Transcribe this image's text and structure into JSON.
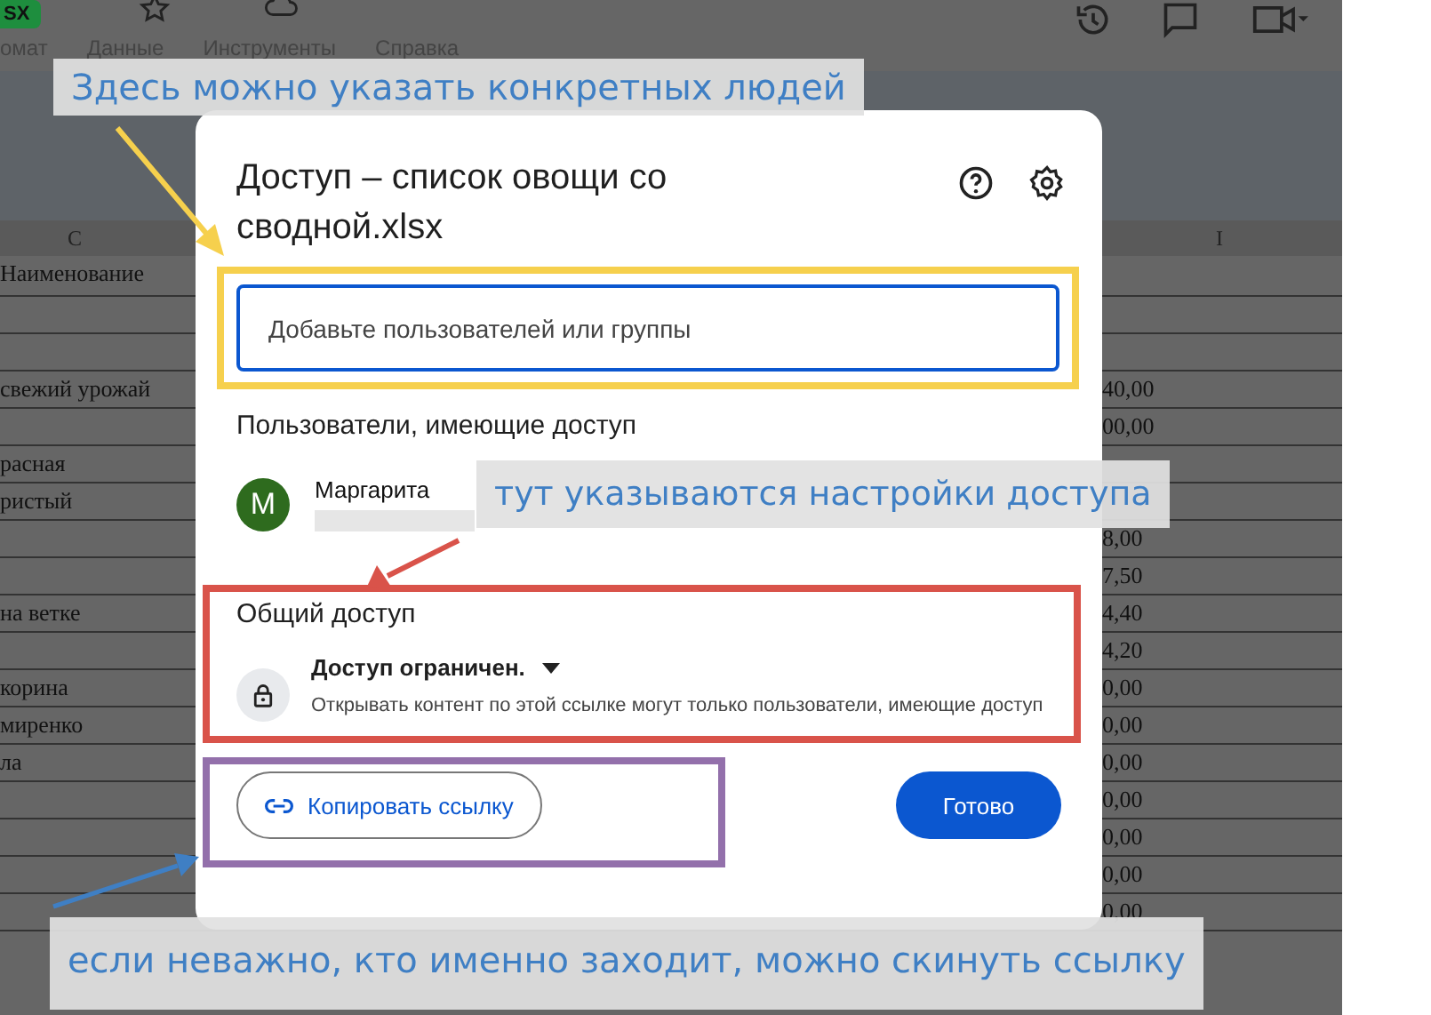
{
  "app_bar": {
    "file_badge": "SX",
    "menu": [
      "омат",
      "Данные",
      "Инструменты",
      "Справка"
    ]
  },
  "sheet": {
    "columns": [
      "C",
      "I"
    ],
    "header": "Наименование",
    "rows": [
      {},
      {},
      {
        "name": "свежий урожай",
        "amount": "40,00"
      },
      {
        "amount": "00,00"
      },
      {
        "name": "расная"
      },
      {
        "name": "ристый"
      },
      {
        "amount": "8,00"
      },
      {
        "amount": "7,50"
      },
      {
        "name": "на ветке",
        "amount": "4,40"
      },
      {
        "amount": "4,20"
      },
      {
        "name": "корина",
        "amount": "0,00"
      },
      {
        "name": "миренко",
        "amount": "0,00"
      },
      {
        "name": "ла",
        "amount": "0,00"
      },
      {
        "amount": "0,00"
      },
      {
        "amount": "0,00"
      },
      {
        "amount": "0,00"
      },
      {
        "amount": "0,00"
      }
    ]
  },
  "dialog": {
    "title": "Доступ – список овощи со сводной.xlsx",
    "search": {
      "placeholder": "Добавьте пользователей или группы"
    },
    "users_heading": "Пользователи, имеющие доступ",
    "users": [
      {
        "initial": "M",
        "name": "Маргарита",
        "color": "#2e6b1e"
      }
    ],
    "general_heading": "Общий доступ",
    "access": {
      "label": "Доступ ограничен.",
      "description": "Открывать контент по этой ссылке могут только пользователи, имеющие доступ"
    },
    "copy_link": "Копировать ссылку",
    "done": "Готово"
  },
  "annotations": [
    {
      "text": "Здесь можно указать конкретных людей",
      "kind": "top"
    },
    {
      "text": "тут указываются настройки доступа",
      "kind": "middle"
    },
    {
      "text": "если  неважно, кто именно заходит, можно скинуть ссылку",
      "kind": "bottom"
    }
  ],
  "frames": [
    {
      "kind": "search",
      "color": "#f6d04d"
    },
    {
      "kind": "general",
      "color": "#d9534a"
    },
    {
      "kind": "link",
      "color": "#9370ab"
    }
  ]
}
